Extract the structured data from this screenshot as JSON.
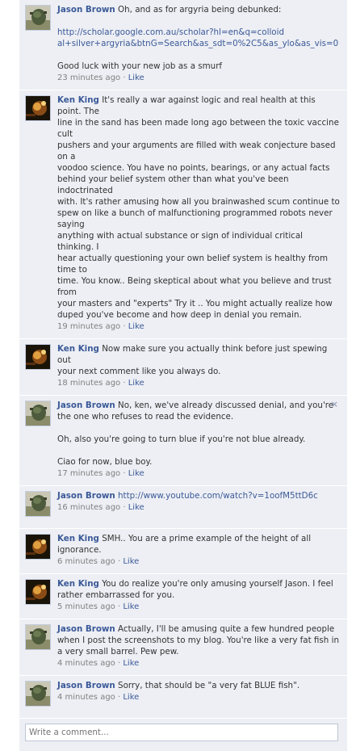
{
  "comments": [
    {
      "author": "Jason Brown",
      "avatar": "jason",
      "lines": [
        "Oh, and as for argyria being debunked:"
      ],
      "link_lines": [
        "http://scholar.google.com.au/scholar?hl=en&q=colloid",
        "al+silver+argyria&btnG=Search&as_sdt=0%2C5&as_ylo&as_vis=0"
      ],
      "extra": "Good luck with your new job as a smurf",
      "time": "23 minutes ago",
      "like": "Like"
    },
    {
      "author": "Ken King",
      "avatar": "ken",
      "lines": [
        "It's really a war against logic and real health at this point. The",
        "line in the sand has been made long ago between the toxic vaccine cult",
        "pushers and your arguments are filled with weak conjecture based on a",
        "voodoo science. You have no points, bearings, or any actual facts",
        "behind your belief system other than what you've been indoctrinated",
        "with. It's rather amusing how all you brainwashed scum continue to",
        "spew on like a bunch of malfunctioning programmed robots never saying",
        "anything with actual substance or sign of individual critical thinking. I",
        "hear actually questioning your own belief system is healthy from time to",
        "time. You know.. Being skeptical about what you believe and trust from",
        "your masters and \"experts\" Try it .. You might actually realize how",
        "duped you've become and how deep in denial you remain."
      ],
      "time": "19 minutes ago",
      "like": "Like"
    },
    {
      "author": "Ken King",
      "avatar": "ken",
      "lines": [
        "Now make sure you actually think before just spewing out",
        "your next comment like you always do."
      ],
      "time": "18 minutes ago",
      "like": "Like"
    },
    {
      "author": "Jason Brown",
      "avatar": "jason",
      "lines": [
        "No, ken, we've already discussed denial, and you're",
        "the one who refuses to read the evidence."
      ],
      "paras": [
        "Oh, also you're going to turn blue if you're not blue already.",
        "Ciao for now, blue boy."
      ],
      "close": "×",
      "time": "17 minutes ago",
      "like": "Like"
    },
    {
      "author": "Jason Brown",
      "avatar": "jason",
      "link_inline": "http://www.youtube.com/watch?v=1oofM5ttD6c",
      "lines": [],
      "time": "16 minutes ago",
      "like": "Like"
    },
    {
      "author": "Ken King",
      "avatar": "ken",
      "lines": [
        "SMH.. You are a prime example of the height of all ignorance."
      ],
      "time": "6 minutes ago",
      "like": "Like"
    },
    {
      "author": "Ken King",
      "avatar": "ken",
      "lines": [
        "You do realize you're only amusing yourself Jason. I feel",
        "rather embarrassed for you."
      ],
      "time": "5 minutes ago",
      "like": "Like"
    },
    {
      "author": "Jason Brown",
      "avatar": "jason",
      "lines": [
        "Actually, I'll be amusing quite a few hundred people",
        "when I post the screenshots to my blog. You're like a very fat fish in",
        "a very small barrel. Pew pew."
      ],
      "time": "4 minutes ago",
      "like": "Like"
    },
    {
      "author": "Jason Brown",
      "avatar": "jason",
      "lines": [
        "Sorry, that should be \"a very fat BLUE fish\"."
      ],
      "time": "4 minutes ago",
      "like": "Like"
    }
  ],
  "composer": {
    "placeholder": "Write a comment..."
  },
  "separator": "·",
  "colors": {
    "link": "#3b5998",
    "background": "#edeff4",
    "meta": "#808080"
  }
}
